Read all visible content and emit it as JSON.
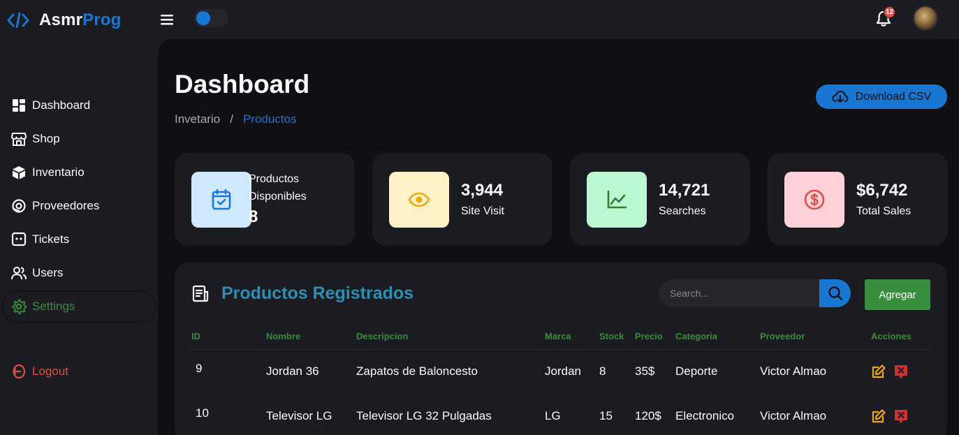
{
  "brand": {
    "part1": "Asmr",
    "part2": "Prog",
    "icon": "code-icon"
  },
  "topbar": {
    "notification_count": "12",
    "theme_toggle": "dark"
  },
  "sidebar": {
    "items": [
      {
        "label": "Dashboard",
        "icon": "dashboard-grid-icon"
      },
      {
        "label": "Shop",
        "icon": "store-icon"
      },
      {
        "label": "Inventario",
        "icon": "box-icon"
      },
      {
        "label": "Proveedores",
        "icon": "donate-icon"
      },
      {
        "label": "Tickets",
        "icon": "message-dots-icon"
      },
      {
        "label": "Users",
        "icon": "group-icon"
      },
      {
        "label": "Settings",
        "icon": "cog-icon",
        "active": true
      }
    ],
    "logout": "Logout"
  },
  "header": {
    "title": "Dashboard",
    "breadcrumb": [
      "Invetario",
      "/",
      "Productos"
    ],
    "download_label": "Download CSV"
  },
  "cards": [
    {
      "label": "Productos Disponibles",
      "value": "8",
      "icon": "calendar-check-icon",
      "color": "#cfe8ff"
    },
    {
      "value": "3,944",
      "label": "Site Visit",
      "icon": "eye-icon",
      "color": "#fff2c6"
    },
    {
      "value": "14,721",
      "label": "Searches",
      "icon": "line-chart-icon",
      "color": "#bbf7d0"
    },
    {
      "value": "$6,742",
      "label": "Total Sales",
      "icon": "dollar-circle-icon",
      "color": "#ffd0d5"
    }
  ],
  "products": {
    "title": "Productos Registrados",
    "search_placeholder": "Search...",
    "add_label": "Agregar",
    "columns": [
      "ID",
      "Nombre",
      "Descripcion",
      "Marca",
      "Stock",
      "Precio",
      "Categoria",
      "Proveedor",
      "Acciones"
    ],
    "rows": [
      {
        "id": "9",
        "nombre": "Jordan 36",
        "descripcion": "Zapatos de Baloncesto",
        "marca": "Jordan",
        "stock": "8",
        "precio": "35$",
        "categoria": "Deporte",
        "proveedor": "Victor Almao"
      },
      {
        "id": "10",
        "nombre": "Televisor LG",
        "descripcion": "Televisor LG 32 Pulgadas",
        "marca": "LG",
        "stock": "15",
        "precio": "120$",
        "categoria": "Electronico",
        "proveedor": "Victor Almao"
      }
    ]
  },
  "colors": {
    "accent": "#1976d2",
    "success": "#388e3c",
    "danger": "#db504a",
    "title": "#2e8fb4",
    "warning": "#f0a70a"
  }
}
